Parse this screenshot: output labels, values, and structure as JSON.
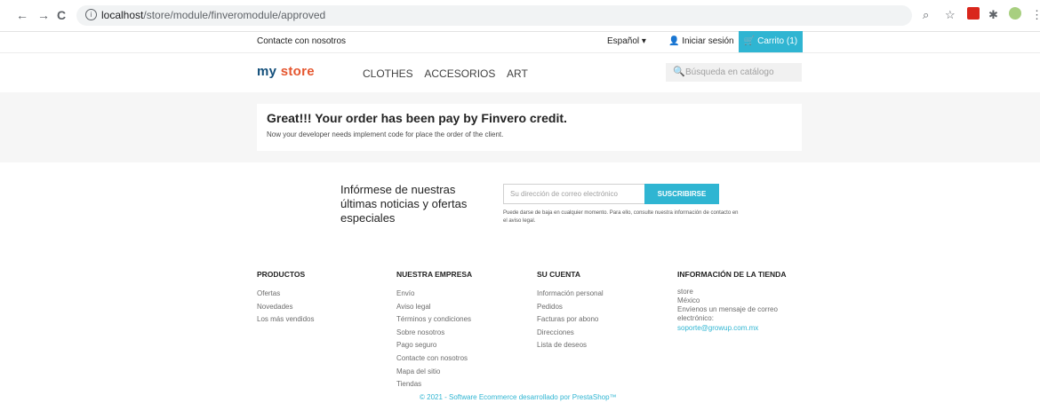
{
  "browser": {
    "back_icon": "←",
    "forward_icon": "→",
    "reload_icon": "C",
    "url_host": "localhost",
    "url_path": "/store/module/finveromodule/approved"
  },
  "topbar": {
    "contact": "Contacte con nosotros",
    "language": "Español ▾",
    "login": "Iniciar sesión",
    "cart": "Carrito (1)"
  },
  "header": {
    "logo_part1": "my ",
    "logo_part2": "store",
    "menu": [
      "CLOTHES",
      "ACCESORIOS",
      "ART"
    ],
    "search_placeholder": "Búsqueda en catálogo"
  },
  "main": {
    "heading": "Great!!! Your order has been pay by Finvero credit.",
    "subtext": "Now your developer needs implement code for place the order of the client."
  },
  "newsletter": {
    "text": "Infórmese de nuestras últimas noticias y ofertas especiales",
    "email_placeholder": "Su dirección de correo electrónico",
    "button": "SUSCRIBIRSE",
    "note": "Puede darse de baja en cualquier momento. Para ello, consulte nuestra información de contacto en el aviso legal."
  },
  "footer": {
    "productos": {
      "title": "PRODUCTOS",
      "items": [
        "Ofertas",
        "Novedades",
        "Los más vendidos"
      ]
    },
    "empresa": {
      "title": "NUESTRA EMPRESA",
      "items": [
        "Envío",
        "Aviso legal",
        "Términos y condiciones",
        "Sobre nosotros",
        "Pago seguro",
        "Contacte con nosotros",
        "Mapa del sitio",
        "Tiendas"
      ]
    },
    "cuenta": {
      "title": "SU CUENTA",
      "items": [
        "Información personal",
        "Pedidos",
        "Facturas por abono",
        "Direcciones",
        "Lista de deseos"
      ]
    },
    "tienda": {
      "title": "INFORMACIÓN DE LA TIENDA",
      "lines": [
        "store",
        "México",
        "Envíenos un mensaje de correo electrónico:"
      ],
      "email": "soporte@growup.com.mx"
    },
    "copyright": "© 2021 - Software Ecommerce desarrollado por PrestaShop™"
  }
}
